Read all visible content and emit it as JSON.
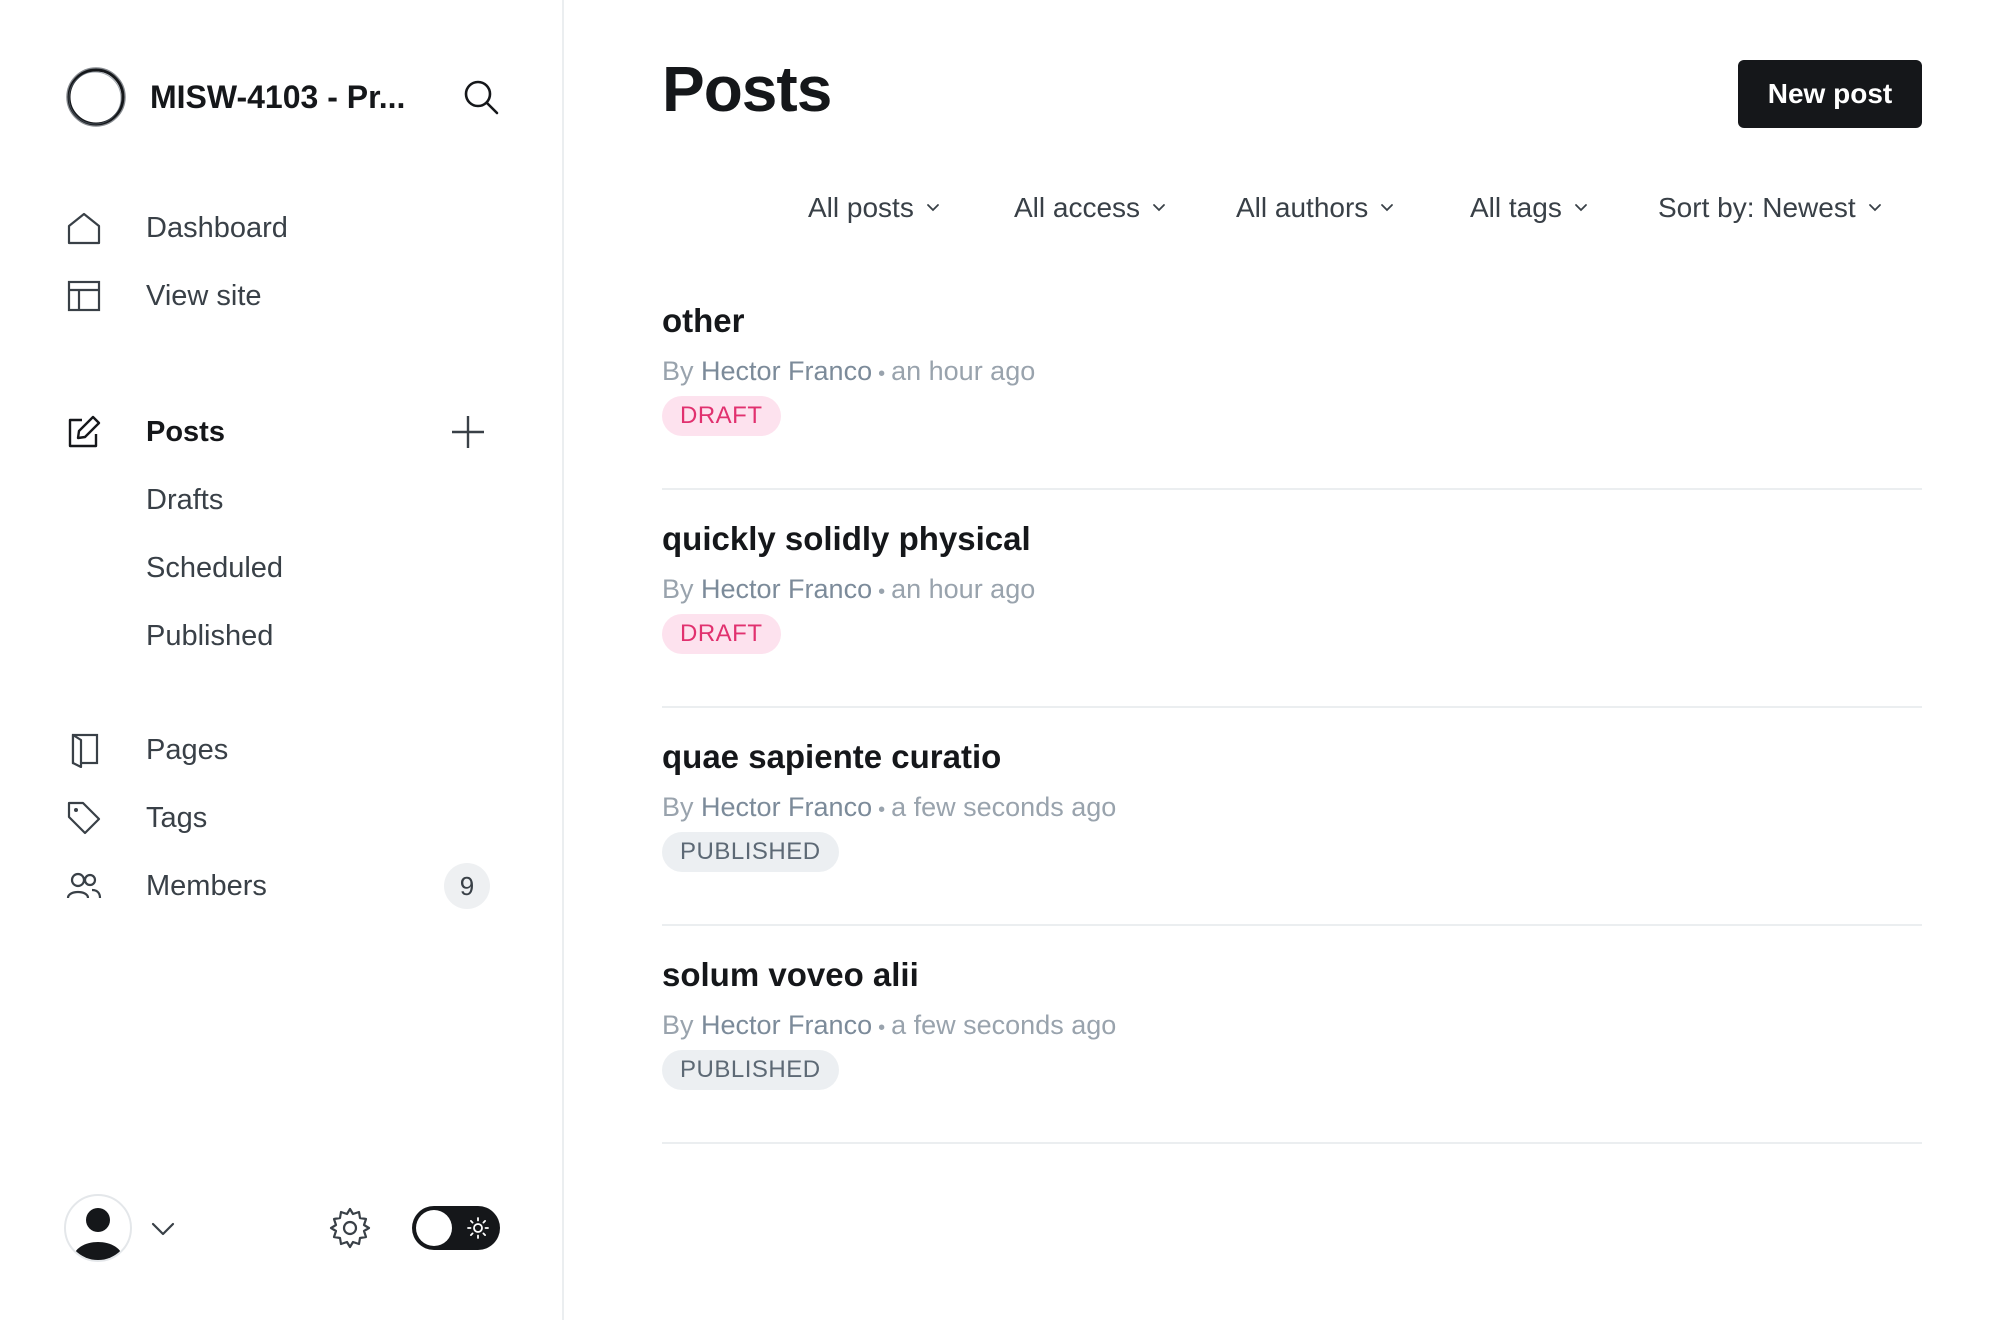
{
  "sidebar": {
    "site_title": "MISW-4103 - Pr...",
    "nav_primary": [
      {
        "label": "Dashboard",
        "icon": "home-icon"
      },
      {
        "label": "View site",
        "icon": "layout-icon"
      }
    ],
    "posts": {
      "label": "Posts",
      "icon": "edit-icon",
      "sub_items": [
        "Drafts",
        "Scheduled",
        "Published"
      ]
    },
    "nav_secondary": [
      {
        "label": "Pages",
        "icon": "page-icon"
      },
      {
        "label": "Tags",
        "icon": "tag-icon"
      },
      {
        "label": "Members",
        "icon": "members-icon",
        "count": "9"
      }
    ]
  },
  "header": {
    "title": "Posts",
    "new_post_label": "New post"
  },
  "filters": {
    "type": "All posts",
    "access": "All access",
    "authors": "All authors",
    "tags": "All tags",
    "sort": "Sort by: Newest"
  },
  "posts": [
    {
      "title": "other",
      "by": "By",
      "author": "Hector Franco",
      "time": "an hour ago",
      "status": "DRAFT",
      "status_kind": "draft"
    },
    {
      "title": "quickly solidly physical",
      "by": "By",
      "author": "Hector Franco",
      "time": "an hour ago",
      "status": "DRAFT",
      "status_kind": "draft"
    },
    {
      "title": "quae sapiente curatio",
      "by": "By",
      "author": "Hector Franco",
      "time": "a few seconds ago",
      "status": "PUBLISHED",
      "status_kind": "published"
    },
    {
      "title": "solum voveo alii",
      "by": "By",
      "author": "Hector Franco",
      "time": "a few seconds ago",
      "status": "PUBLISHED",
      "status_kind": "published"
    }
  ],
  "colors": {
    "accent_dark": "#15171a",
    "draft_bg": "#fde2ee",
    "draft_text": "#e1316f",
    "published_bg": "#eceff2",
    "published_text": "#5d6975"
  }
}
